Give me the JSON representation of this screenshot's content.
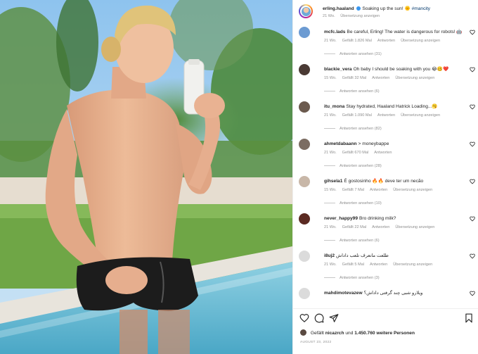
{
  "post": {
    "username": "erling.haaland",
    "caption": "Soaking up the sun!",
    "emoji": "🌞",
    "hashtag": "#mancity",
    "time": "21 Wo.",
    "translate": "Übersetzung anzeigen"
  },
  "comments": [
    {
      "user": "mcfc.lads",
      "text": "Be careful, Erling! The water is dangerous for robots! 🤖",
      "time": "21 Wo.",
      "likes": "Gefällt 1.826 Mal",
      "reply": "Antworten",
      "translate": "Übersetzung anzeigen",
      "replies": "Antworten ansehen (31)",
      "avatar_color": "#6c9bd2"
    },
    {
      "user": "blackie_vera",
      "text": "Oh baby I should be soaking with you 😂🥴❤️",
      "time": "15 Wo.",
      "likes": "Gefällt 32 Mal",
      "reply": "Antworten",
      "translate": "Übersetzung anzeigen",
      "replies": "Antworten ansehen (6)",
      "avatar_color": "#4a3a34"
    },
    {
      "user": "itu_mona",
      "text": "Stay hydrated, Haaland Hatrick Loading...🥱",
      "time": "21 Wo.",
      "likes": "Gefällt 1.090 Mal",
      "reply": "Antworten",
      "translate": "Übersetzung anzeigen",
      "replies": "Antworten ansehen (82)",
      "avatar_color": "#6b5a4e"
    },
    {
      "user": "ahmetdabaann",
      "text": "> moneybappe",
      "time": "21 Wo.",
      "likes": "Gefällt 670 Mal",
      "reply": "Antworten",
      "translate": "",
      "replies": "Antworten ansehen (28)",
      "avatar_color": "#7b6c62"
    },
    {
      "user": "gihsela1",
      "text": "É gostosinho 🔥🔥 deve ter um necão",
      "time": "15 Wo.",
      "likes": "Gefällt 7 Mal",
      "reply": "Antworten",
      "translate": "Übersetzung anzeigen",
      "replies": "Antworten ansehen (10)",
      "avatar_color": "#c8b7a8"
    },
    {
      "user": "never_happy99",
      "text": "Bro drinking milk?",
      "time": "21 Wo.",
      "likes": "Gefällt 22 Mal",
      "reply": "Antworten",
      "translate": "Übersetzung anzeigen",
      "replies": "Antworten ansehen (6)",
      "avatar_color": "#5b2a22"
    },
    {
      "user": "i8uj2",
      "text": "طلعت ماتعرف تلعب داداش",
      "time": "21 Wo.",
      "likes": "Gefällt 5 Mal",
      "reply": "Antworten",
      "translate": "Übersetzung anzeigen",
      "replies": "Antworten ansehen (3)",
      "avatar_color": "#dbdbdb"
    },
    {
      "user": "mahdimotevazew",
      "text": "ویلارو شبی چند گرفتی داداش؟",
      "time": "",
      "likes": "",
      "reply": "",
      "translate": "",
      "replies": "",
      "avatar_color": "#dbdbdb"
    }
  ],
  "actions": {
    "like_icon": "heart-outline-icon",
    "comment_icon": "comment-bubble-icon",
    "share_icon": "paper-plane-icon",
    "save_icon": "bookmark-icon"
  },
  "likes_line": {
    "prefix": "Gefällt",
    "user": "nicazrch",
    "middle": "und",
    "count": "1.450.760 weitere Personen"
  },
  "date": "AUGUST 23, 2022",
  "colors": {
    "link": "#00376b",
    "muted": "#8e8e8e",
    "verified": "#3897f0"
  }
}
